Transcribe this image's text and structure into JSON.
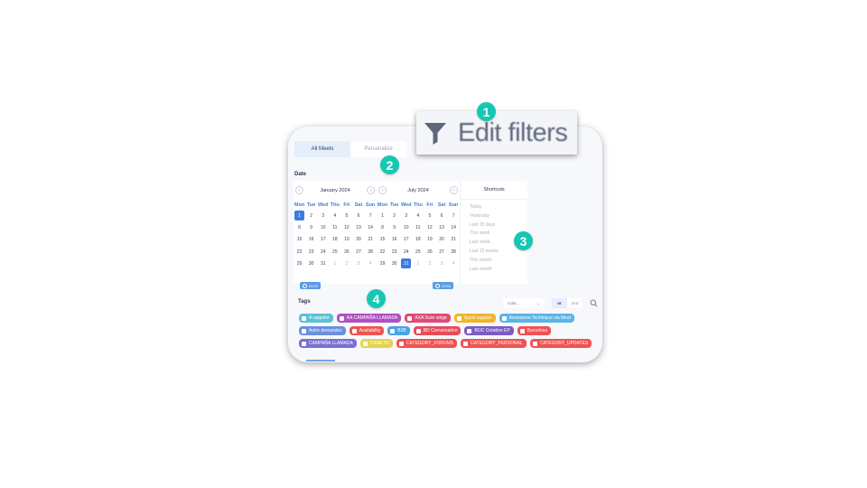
{
  "tabs": [
    "All Meets",
    "Personalize"
  ],
  "date_label": "Date",
  "calendar_left": {
    "month": "January 2024",
    "dow": [
      "Mon",
      "Tue",
      "Wed",
      "Thu",
      "Fri",
      "Sat",
      "Sun"
    ],
    "days": [
      "1",
      "2",
      "3",
      "4",
      "5",
      "6",
      "7",
      "8",
      "9",
      "10",
      "11",
      "12",
      "13",
      "14",
      "15",
      "16",
      "17",
      "18",
      "19",
      "20",
      "21",
      "22",
      "23",
      "24",
      "25",
      "26",
      "27",
      "28",
      "29",
      "30",
      "31",
      "1",
      "2",
      "3",
      "4"
    ],
    "selected_index": 0,
    "muted_from": 31
  },
  "calendar_right": {
    "month": "July 2024",
    "dow": [
      "Mon",
      "Tue",
      "Wed",
      "Thu",
      "Fri",
      "Sat",
      "Sun"
    ],
    "days": [
      "1",
      "2",
      "3",
      "4",
      "5",
      "6",
      "7",
      "8",
      "9",
      "10",
      "11",
      "12",
      "13",
      "14",
      "15",
      "16",
      "17",
      "18",
      "19",
      "20",
      "21",
      "22",
      "23",
      "24",
      "25",
      "26",
      "27",
      "28",
      "29",
      "30",
      "31",
      "1",
      "2",
      "3",
      "4"
    ],
    "selected_index": 30,
    "muted_from": 31
  },
  "shortcuts": {
    "title": "Shortcuts",
    "items": [
      "Today",
      "Yesterday",
      "Last 15 days",
      "This week",
      "Last week",
      "Last 15 weeks",
      "This month",
      "Last month"
    ]
  },
  "time_start": "00:00",
  "time_end": "23:59",
  "tags_label": "Tags",
  "color_select": "color...",
  "or_label": "or",
  "and_label": "and",
  "tag_rows": [
    [
      {
        "label": "A rappeler",
        "color": "#5bc0d6"
      },
      {
        "label": "AA CAMPAÑA LLAMADA",
        "color": "#b050c0"
      },
      {
        "label": "AXA Suivi siège",
        "color": "#e04a7a"
      },
      {
        "label": "Appel support",
        "color": "#f0b429"
      },
      {
        "label": "Assistance Technique via Meet",
        "color": "#5ab4e6"
      }
    ],
    [
      {
        "label": "Autre demandes",
        "color": "#6b8fe0"
      },
      {
        "label": "Availability",
        "color": "#ef5350"
      },
      {
        "label": "B2B",
        "color": "#4aa3e6"
      },
      {
        "label": "BD Conversation",
        "color": "#e84c5a"
      },
      {
        "label": "BOC Création EP",
        "color": "#7b5cc4"
      },
      {
        "label": "Barcelona",
        "color": "#f05252"
      }
    ],
    [
      {
        "label": "CAMPAÑA LLAMADA",
        "color": "#7b6fd0"
      },
      {
        "label": "CASE V2",
        "color": "#e6d44a"
      },
      {
        "label": "CATEGORY_FORUMS",
        "color": "#ef5350"
      },
      {
        "label": "CATEGORY_PERSONAL",
        "color": "#ef5350"
      },
      {
        "label": "CATEGORY_UPDATES",
        "color": "#ef5350"
      }
    ]
  ],
  "popup_title": "Edit filters",
  "badges": [
    "1",
    "2",
    "3",
    "4"
  ]
}
